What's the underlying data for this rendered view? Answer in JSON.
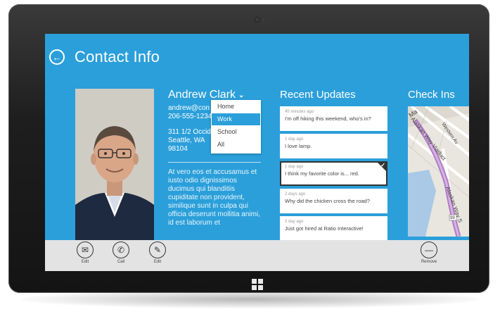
{
  "header": {
    "back_icon": "back-arrow-icon",
    "title": "Contact Info"
  },
  "contact": {
    "name": "Andrew Clark",
    "email": "andrew@con",
    "phone": "206-555-1234",
    "address_line1": "311 1/2 Occide",
    "address_line2": "Seattle, WA",
    "address_line3": "98104",
    "bio": "At vero eos et accusamus et iusto odio dignissimos ducimus qui blanditiis cupiditate non provident, similique sunt in culpa qui officia deserunt mollitia animi, id est laborum et"
  },
  "dropdown": {
    "items": [
      "Home",
      "Work",
      "School",
      "All"
    ],
    "selected": "Work"
  },
  "updates": {
    "title": "Recent Updates",
    "items": [
      {
        "time": "45 minutes ago",
        "text": "I'm off hiking this weekend, who's in?"
      },
      {
        "time": "1 day ago",
        "text": "I love lamp."
      },
      {
        "time": "1 day ago",
        "text": "I think my favorite color is... red."
      },
      {
        "time": "2 days ago",
        "text": "Why did the chicken cross the road?"
      },
      {
        "time": "3 day ago",
        "text": "Just got hired at Ratio Interactive!"
      }
    ]
  },
  "checkins": {
    "title": "Check Ins",
    "map_labels": [
      "Ma",
      "Western Av",
      "Alaskan Way Viaduct",
      "Alaskan Way S",
      "99"
    ]
  },
  "appbar": {
    "email_label": "Edit",
    "call_label": "Call",
    "edit_label": "Edit",
    "remove_label": "Remove"
  },
  "colors": {
    "accent": "#2b9fda",
    "appbar": "#e3e3e3",
    "bezel": "#1e1e1e"
  }
}
